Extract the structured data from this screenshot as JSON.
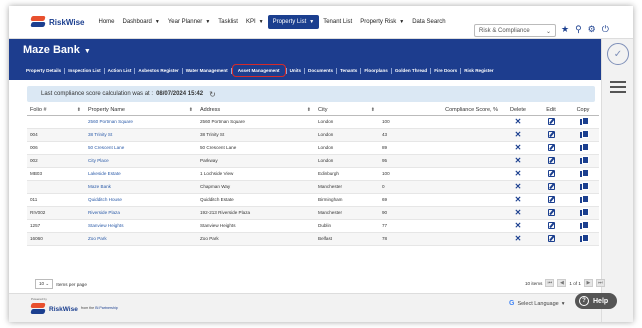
{
  "app": {
    "logo_text": "RiskWise"
  },
  "topnav": {
    "items": [
      {
        "label": "Home",
        "caret": false
      },
      {
        "label": "Dashboard",
        "caret": true
      },
      {
        "label": "Year Planner",
        "caret": true
      },
      {
        "label": "Tasklist",
        "caret": false
      },
      {
        "label": "KPI",
        "caret": true
      },
      {
        "label": "Property List",
        "caret": true,
        "active": true
      },
      {
        "label": "Tenant List",
        "caret": false
      },
      {
        "label": "Property Risk",
        "caret": true
      },
      {
        "label": "Data Search",
        "caret": false
      }
    ],
    "org_select": "Risk & Compliance",
    "icons": [
      "star-icon",
      "search-icon",
      "gear-icon",
      "power-icon"
    ]
  },
  "banner": {
    "title": "Maze Bank",
    "subnav": [
      "Property Details",
      "Inspection List",
      "Action List",
      "Asbestos Register",
      "Water Management",
      "Asset Management",
      "Units",
      "Documents",
      "Tenants",
      "Floorplans",
      "Golden Thread",
      "Fire Doors",
      "Risk Register"
    ],
    "active_subnav": "Asset Management"
  },
  "info": {
    "prefix": "Last compliance score calculation was at :",
    "timestamp": "08/07/2024 15:42"
  },
  "table": {
    "headers": [
      "Folio #",
      "Property Name",
      "Address",
      "City",
      "Compliance Score, %",
      "Delete",
      "Edit",
      "Copy"
    ],
    "rows": [
      {
        "folio": "",
        "name": "2560 Portman Square",
        "address": "2560 Portman Square",
        "city": "London",
        "score": "100"
      },
      {
        "folio": "004",
        "name": "38 Trinity St",
        "address": "38 Trinity St",
        "city": "London",
        "score": "43"
      },
      {
        "folio": "006",
        "name": "50 Crescent Lane",
        "address": "50 Crescent Lane",
        "city": "London",
        "score": "89"
      },
      {
        "folio": "002",
        "name": "City Place",
        "address": "Parkway",
        "city": "London",
        "score": "95"
      },
      {
        "folio": "MB03",
        "name": "Lakeside Estate",
        "address": "1 Lochside View",
        "city": "Edinburgh",
        "score": "100"
      },
      {
        "folio": "",
        "name": "Maze Bank",
        "address": "Chapman Way",
        "city": "Manchester",
        "score": "0"
      },
      {
        "folio": "011",
        "name": "Quidditch House",
        "address": "Quidditch Estate",
        "city": "Birmingham",
        "score": "69"
      },
      {
        "folio": "RIV002",
        "name": "Riverside Plaza",
        "address": "192-213 Riverside Plaza",
        "city": "Manchester",
        "score": "90"
      },
      {
        "folio": "1257",
        "name": "Stanview Heights",
        "address": "Stanview Heights",
        "city": "Dublin",
        "score": "77"
      },
      {
        "folio": "16060",
        "name": "Zoo Park",
        "address": "Zoo Park",
        "city": "Belfast",
        "score": "78"
      }
    ]
  },
  "paging": {
    "page_size": "10",
    "page_size_label": "Items per page",
    "items_label": "10 items",
    "page_label": "1 of 1"
  },
  "footer": {
    "powered_by": "Powered by",
    "from_prefix": "from the",
    "from_link": "Bi Partnership",
    "translate_label": "Select Language",
    "help_label": "Help"
  }
}
